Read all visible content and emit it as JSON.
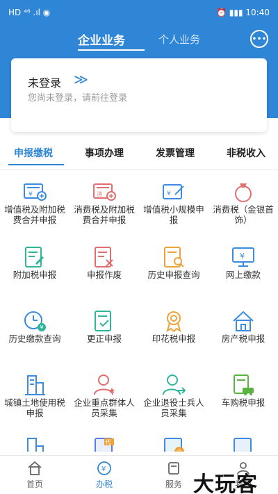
{
  "status_bar": {
    "left": "HD ⁴⁶ .ıl  ◉",
    "right": "⏰ ▮▮▮ 10:40"
  },
  "header": {
    "tab_active": "企业业务",
    "tab_other": "个人业务",
    "chat_icon": "chat-bubble-icon"
  },
  "login": {
    "title": "未登录",
    "arrow": "≫",
    "subtitle": "您尚未登录，请前往登录"
  },
  "categories": {
    "items": [
      "申报缴税",
      "事项办理",
      "发票管理",
      "非税收入"
    ],
    "active_index": 0
  },
  "services": [
    {
      "label": "增值税及附加税费合并申报",
      "icon": "vat-merged-icon"
    },
    {
      "label": "消费税及附加税费合并申报",
      "icon": "consumption-merged-icon"
    },
    {
      "label": "增值税小规模申报",
      "icon": "vat-small-scale-icon"
    },
    {
      "label": "消费税（金银首饰）",
      "icon": "jewelry-ring-icon"
    },
    {
      "label": "附加税申报",
      "icon": "surtax-icon"
    },
    {
      "label": "申报作废",
      "icon": "void-declaration-icon"
    },
    {
      "label": "历史申报查询",
      "icon": "history-search-icon"
    },
    {
      "label": "网上缴款",
      "icon": "online-payment-icon"
    },
    {
      "label": "历史缴款查询",
      "icon": "history-payment-icon"
    },
    {
      "label": "更正申报",
      "icon": "correction-icon"
    },
    {
      "label": "印花税申报",
      "icon": "stamp-award-icon"
    },
    {
      "label": "房产税申报",
      "icon": "house-icon"
    },
    {
      "label": "城镇土地使用税申报",
      "icon": "building-land-icon"
    },
    {
      "label": "企业重点群体人员采集",
      "icon": "person-star-icon"
    },
    {
      "label": "企业退役士兵人员采集",
      "icon": "person-arrow-icon"
    },
    {
      "label": "车购税申报",
      "icon": "car-doc-icon"
    },
    {
      "label": "",
      "icon": "building-icon"
    },
    {
      "label": "",
      "icon": "doc-dai-icon"
    },
    {
      "label": "",
      "icon": "doc-qi-icon"
    },
    {
      "label": "",
      "icon": "doc-dai-blue-icon"
    }
  ],
  "bottom_nav": [
    {
      "label": "首页",
      "icon": "home-icon"
    },
    {
      "label": "办税",
      "icon": "tax-yen-icon"
    },
    {
      "label": "服务",
      "icon": "service-icon"
    },
    {
      "label": "我的",
      "icon": "user-icon"
    }
  ],
  "watermark": "大玩客",
  "colors": {
    "primary": "#2f86d7",
    "red": "#e26d6d",
    "green": "#2fb59a",
    "orange": "#f0a23a",
    "lightblue": "#3b8ce0"
  }
}
